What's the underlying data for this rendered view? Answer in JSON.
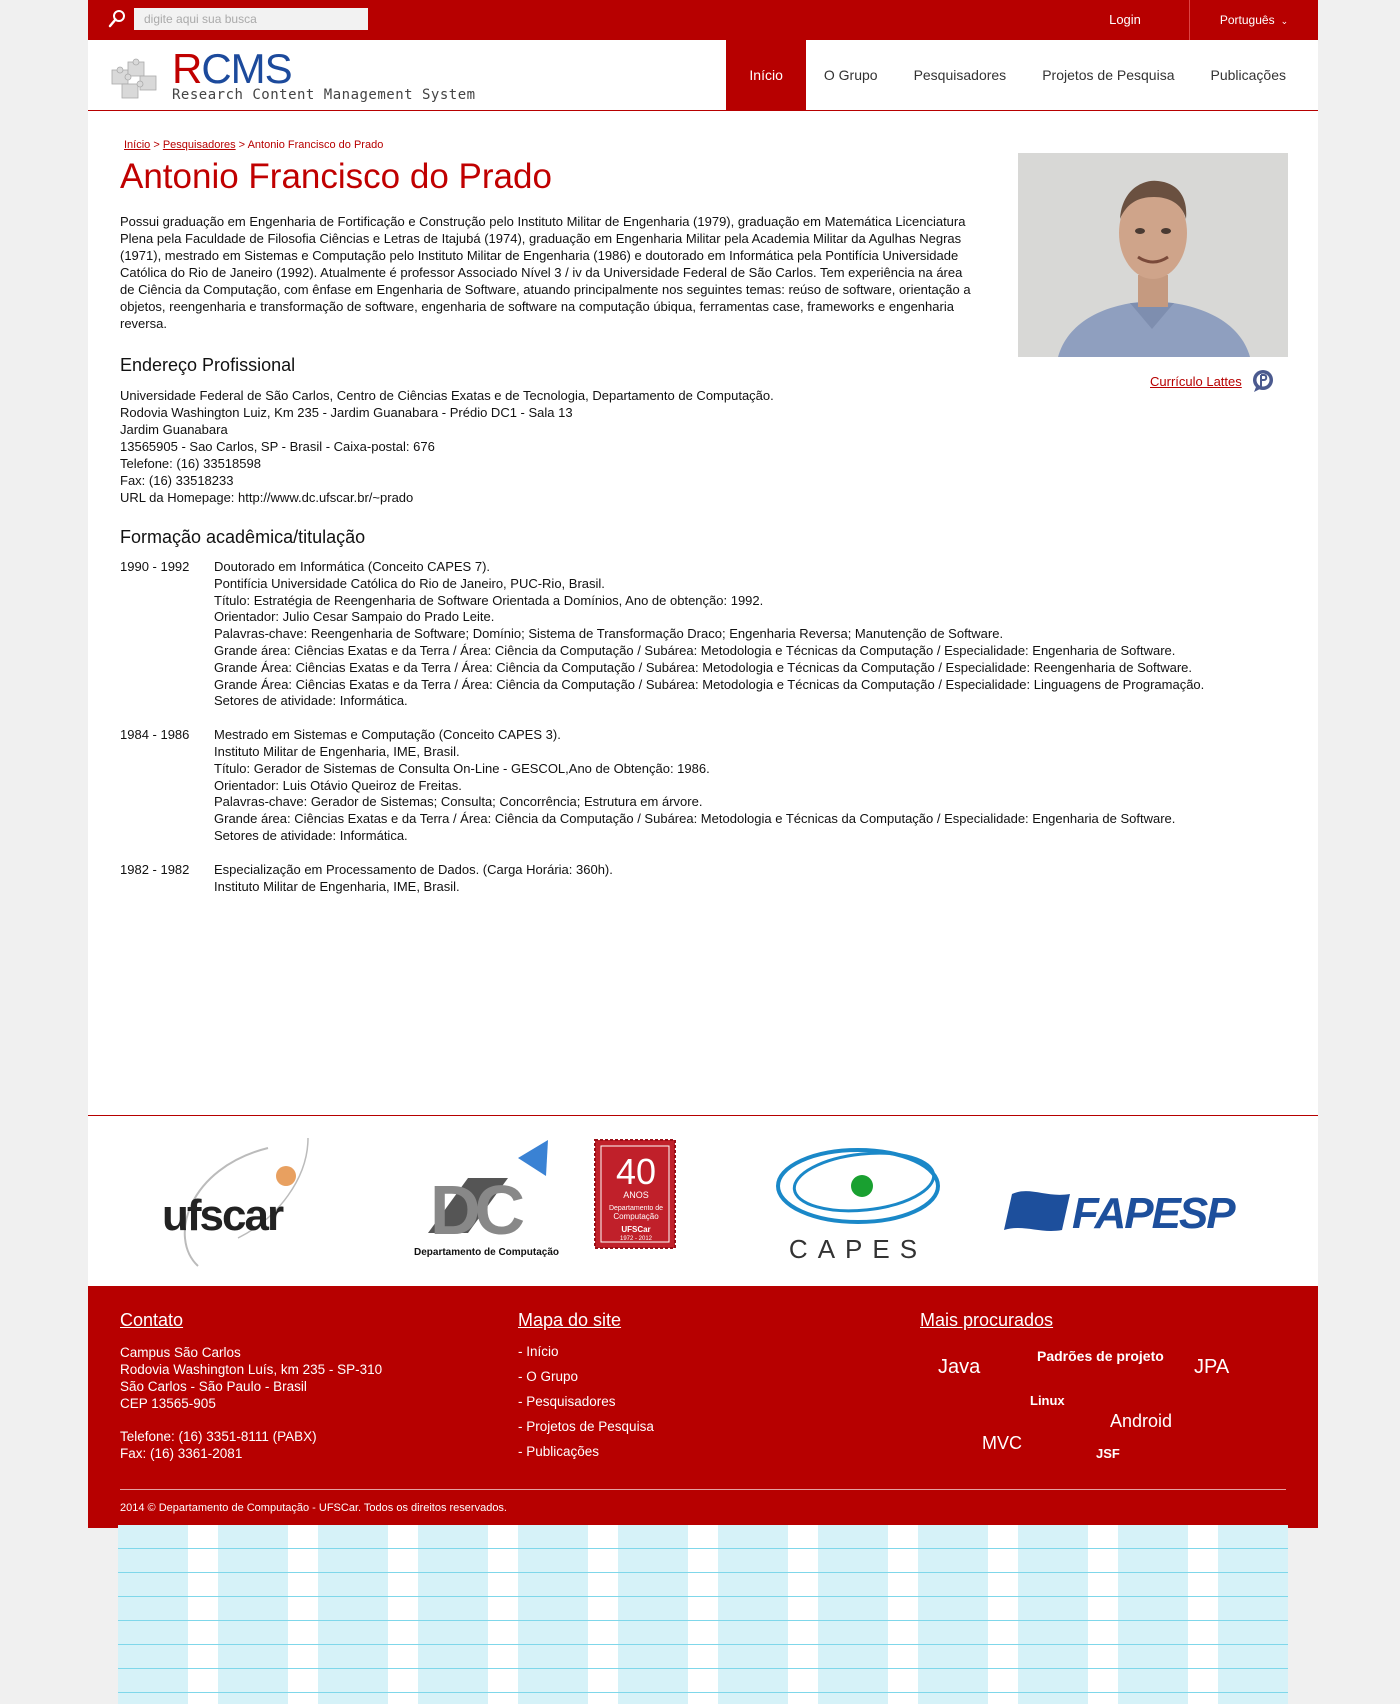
{
  "topbar": {
    "search_placeholder": "digite aqui sua busca",
    "login": "Login",
    "language": "Português"
  },
  "logo": {
    "title_first": "R",
    "title_rest": "CMS",
    "subtitle": "Research Content Management System"
  },
  "nav": [
    {
      "label": "Início",
      "active": true
    },
    {
      "label": "O Grupo"
    },
    {
      "label": "Pesquisadores"
    },
    {
      "label": "Projetos de Pesquisa"
    },
    {
      "label": "Publicações"
    }
  ],
  "breadcrumb": {
    "home": "Início",
    "sep1": " > ",
    "section": "Pesquisadores",
    "sep2": " > ",
    "current": "Antonio Francisco do Prado"
  },
  "profile": {
    "name": "Antonio Francisco do Prado",
    "bio": "Possui graduação em Engenharia de Fortificação e Construção pelo Instituto Militar de Engenharia (1979), graduação em Matemática Licenciatura Plena pela Faculdade de Filosofia Ciências e Letras de Itajubá (1974), graduação em Engenharia Militar pela Academia Militar da Agulhas Negras (1971), mestrado em Sistemas e Computação pelo Instituto Militar de Engenharia (1986) e doutorado em Informática pela Pontifícia Universidade Católica do Rio de Janeiro (1992). Atualmente é professor Associado Nível 3 / iv da Universidade Federal de São Carlos. Tem experiência na área de Ciência da Computação, com ênfase em Engenharia de Software, atuando principalmente nos seguintes temas: reúso de software, orientação a objetos, reengenharia e transformação de software, engenharia de software na computação úbiqua, ferramentas case, frameworks e engenharia reversa.",
    "lattes_label": "Currículo Lattes"
  },
  "address": {
    "heading": "Endereço Profissional",
    "lines": [
      "Universidade Federal de São Carlos, Centro de Ciências Exatas e de Tecnologia, Departamento de Computação.",
      "Rodovia Washington Luiz, Km 235 - Jardim Guanabara - Prédio DC1 - Sala 13",
      "Jardim Guanabara",
      "13565905 - Sao Carlos, SP - Brasil - Caixa-postal: 676",
      "Telefone: (16) 33518598",
      "Fax: (16) 33518233",
      "URL da Homepage: http://www.dc.ufscar.br/~prado"
    ]
  },
  "education": {
    "heading": "Formação acadêmica/titulação",
    "entries": [
      {
        "years": "1990 - 1992",
        "lines": [
          "Doutorado em Informática (Conceito CAPES 7).",
          "Pontifícia Universidade Católica do Rio de Janeiro, PUC-Rio, Brasil.",
          "Título: Estratégia de Reengenharia de Software Orientada a Domínios, Ano de obtenção: 1992.",
          "Orientador: Julio Cesar Sampaio do Prado Leite.",
          "Palavras-chave: Reengenharia de Software; Domínio; Sistema de Transformação Draco; Engenharia Reversa; Manutenção de Software.",
          "Grande área: Ciências Exatas e da Terra / Área: Ciência da Computação / Subárea: Metodologia e Técnicas da Computação / Especialidade: Engenharia de Software.",
          "Grande Área: Ciências Exatas e da Terra / Área: Ciência da Computação / Subárea: Metodologia e Técnicas da Computação / Especialidade: Reengenharia de Software.",
          "Grande Área: Ciências Exatas e da Terra / Área: Ciência da Computação / Subárea: Metodologia e Técnicas da Computação / Especialidade: Linguagens de Programação.",
          "Setores de atividade: Informática."
        ]
      },
      {
        "years": "1984 - 1986",
        "lines": [
          "Mestrado em Sistemas e Computação (Conceito CAPES 3).",
          "Instituto Militar de Engenharia, IME, Brasil.",
          "Título: Gerador de Sistemas de Consulta On-Line - GESCOL,Ano de Obtenção: 1986.",
          "Orientador: Luis Otávio Queiroz de Freitas.",
          "Palavras-chave: Gerador de Sistemas; Consulta; Concorrência; Estrutura em árvore.",
          "Grande área: Ciências Exatas e da Terra / Área: Ciência da Computação / Subárea: Metodologia e Técnicas da Computação / Especialidade: Engenharia de Software.",
          "Setores de atividade: Informática."
        ]
      },
      {
        "years": "1982 - 1982",
        "lines": [
          "Especialização em Processamento de Dados. (Carga Horária: 360h).",
          "Instituto Militar de Engenharia, IME, Brasil."
        ]
      }
    ]
  },
  "partners": {
    "ufscar": "ufscar",
    "dc": "DC",
    "dc_caption": "Departamento de Computação",
    "dc_badge_number": "40",
    "dc_badge_anos": "ANOS",
    "dc_badge_line1": "Departamento de",
    "dc_badge_line2": "Computação",
    "dc_badge_org": "UFSCar",
    "dc_badge_years": "1972 - 2012",
    "capes": "CAPES",
    "fapesp": "FAPESP"
  },
  "footer": {
    "contact_heading": "Contato",
    "contact_lines": [
      "Campus São Carlos",
      "Rodovia Washington Luís, km 235 - SP-310",
      "São Carlos - São Paulo - Brasil",
      "CEP 13565-905"
    ],
    "phone_lines": [
      "Telefone: (16) 3351-8111 (PABX)",
      "Fax: (16) 3361-2081"
    ],
    "sitemap_heading": "Mapa do site",
    "sitemap_links": [
      "- Início",
      "- O Grupo",
      "- Pesquisadores",
      "- Projetos de Pesquisa",
      "- Publicações"
    ],
    "popular_heading": "Mais procurados",
    "tags": [
      "Java",
      "Padrões de projeto",
      "JPA",
      "Linux",
      "Android",
      "MVC",
      "JSF"
    ],
    "copyright": "2014 © Departamento de Computação - UFSCar. Todos os direitos reservados."
  },
  "colors": {
    "brand_red": "#b70000",
    "logo_blue": "#1c4a9c"
  }
}
